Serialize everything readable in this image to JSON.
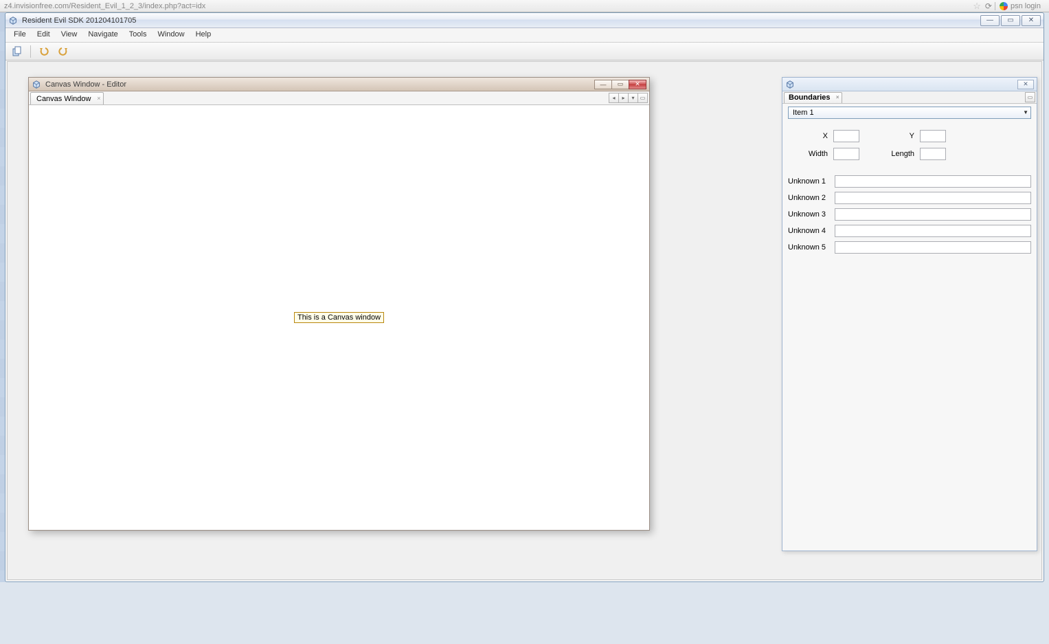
{
  "browser": {
    "url": "z4.invisionfree.com/Resident_Evil_1_2_3/index.php?act=idx",
    "tab2": "psn login"
  },
  "app": {
    "title": "Resident Evil SDK 201204101705"
  },
  "menu": {
    "file": "File",
    "edit": "Edit",
    "view": "View",
    "navigate": "Navigate",
    "tools": "Tools",
    "window": "Window",
    "help": "Help"
  },
  "canvas_window": {
    "title": "Canvas Window - Editor",
    "tab": "Canvas Window",
    "body_text": "This is a Canvas window"
  },
  "panel": {
    "tab": "Boundaries",
    "dropdown_selected": "Item 1",
    "labels": {
      "x": "X",
      "y": "Y",
      "width": "Width",
      "length": "Length",
      "u1": "Unknown 1",
      "u2": "Unknown 2",
      "u3": "Unknown 3",
      "u4": "Unknown 4",
      "u5": "Unknown 5"
    },
    "values": {
      "x": "",
      "y": "",
      "width": "",
      "length": "",
      "u1": "",
      "u2": "",
      "u3": "",
      "u4": "",
      "u5": ""
    }
  }
}
